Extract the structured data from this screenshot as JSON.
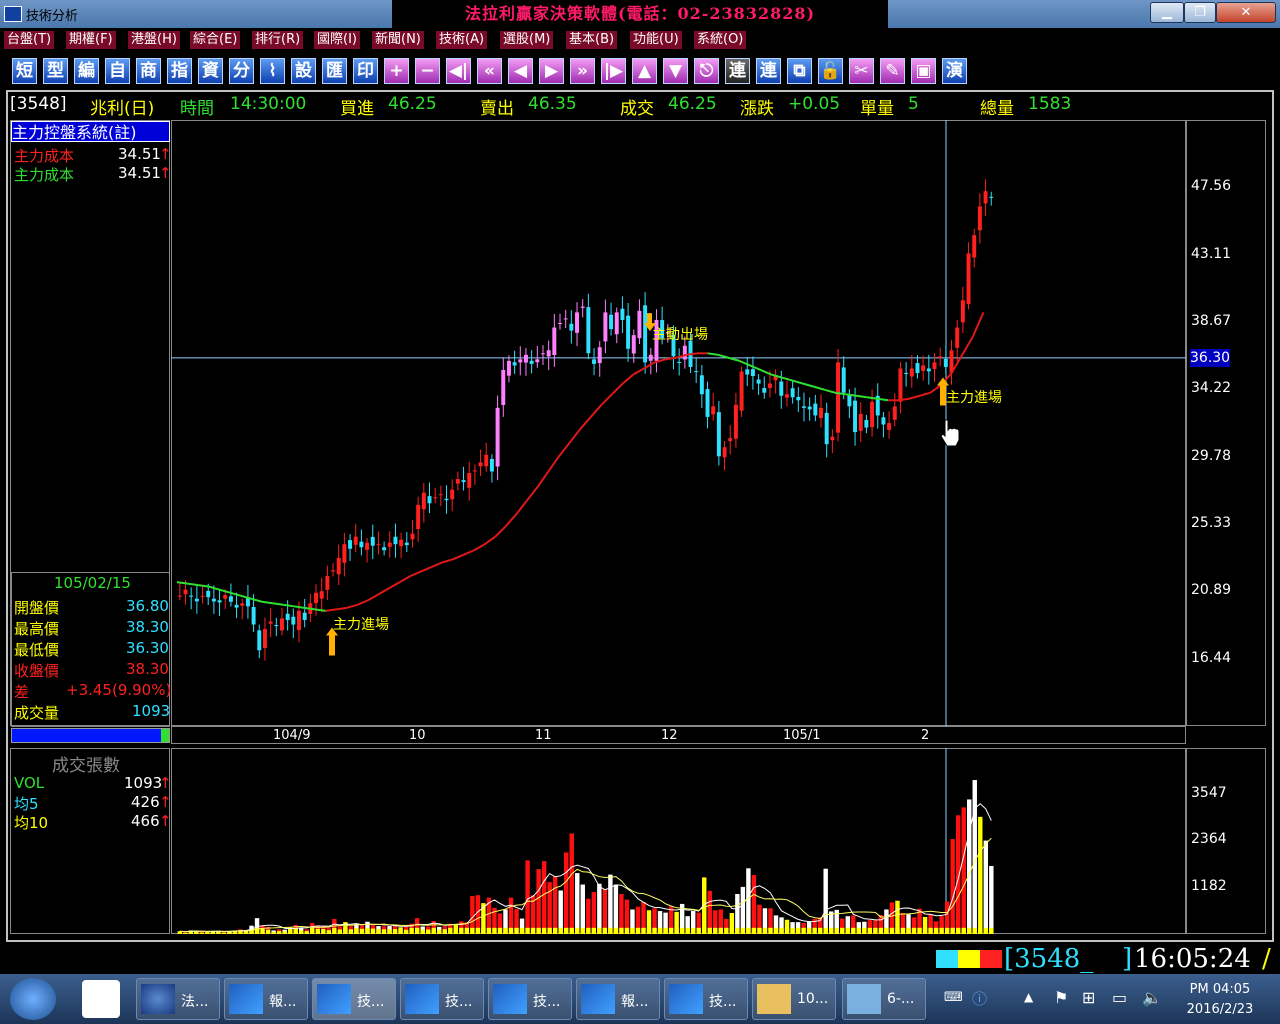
{
  "window": {
    "title": "技術分析",
    "banner": "法拉利贏家決策軟體(電話：02-23832828)"
  },
  "menu": [
    "台盤(T)",
    "期權(F)",
    "港盤(H)",
    "綜合(E)",
    "排行(R)",
    "國際(I)",
    "新聞(N)",
    "技術(A)",
    "選股(M)",
    "基本(B)",
    "功能(U)",
    "系統(O)"
  ],
  "toolbar": {
    "text_buttons": [
      "短",
      "型",
      "編",
      "自",
      "商",
      "指",
      "資",
      "分",
      "設",
      "匯",
      "印"
    ],
    "link_buttons": [
      "連",
      "連",
      "演"
    ]
  },
  "status": {
    "code": "[3548]",
    "name": "兆利(日)",
    "time_label": "時間",
    "time": "14:30:00",
    "buy_label": "買進",
    "buy": "46.25",
    "sell_label": "賣出",
    "sell": "46.35",
    "deal_label": "成交",
    "deal": "46.25",
    "change_label": "漲跌",
    "change": "+0.05",
    "unit_label": "單量",
    "unit": "5",
    "total_label": "總量",
    "total": "1583"
  },
  "indicator": {
    "title": "主力控盤系統(註)",
    "line1_label": "主力成本",
    "line1_value": "34.51",
    "line2_label": "主力成本",
    "line2_value": "34.51"
  },
  "ohlc": {
    "date": "105/02/15",
    "open_label": "開盤價",
    "open": "36.80",
    "high_label": "最高價",
    "high": "38.30",
    "low_label": "最低價",
    "low": "36.30",
    "close_label": "收盤價",
    "close": "38.30",
    "diff_label": "差",
    "diff": "+3.45(9.90%)",
    "vol_label": "成交量",
    "vol": "1093"
  },
  "annotations": {
    "enter1": "主力進場",
    "exit": "主動出場",
    "enter2": "主力進場"
  },
  "crosshair_price": "36.30",
  "volume": {
    "title": "成交張數",
    "vol_label": "VOL",
    "vol": "1093",
    "ma5_label": "均5",
    "ma5": "426",
    "ma10_label": "均10",
    "ma10": "466"
  },
  "clock": {
    "code": "[3548_",
    "time": "16:05:24"
  },
  "taskbar": {
    "items": [
      "法...",
      "報...",
      "技...",
      "技...",
      "技...",
      "報...",
      "技...",
      "10...",
      "6-..."
    ],
    "time": "PM 04:05",
    "date": "2016/2/23"
  },
  "chart_data": {
    "type": "candlestick",
    "y_ticks": [
      "47.56",
      "43.11",
      "38.67",
      "34.22",
      "29.78",
      "25.33",
      "20.89",
      "16.44"
    ],
    "ylim": [
      12.0,
      52.0
    ],
    "x_ticks": [
      "104/9",
      "10",
      "11",
      "12",
      "105/1",
      "2"
    ],
    "volume_ticks": [
      "3547",
      "2364",
      "1182"
    ],
    "volume_ylim": [
      0,
      4700
    ],
    "colors": {
      "up": "#ff2020",
      "down": "#30e0ff",
      "flat": "#ff80ff",
      "ma_up": "#e01818",
      "ma_down": "#30e030",
      "vol_up": "#ff1010",
      "vol_down": "#ffffff",
      "vol_other": "#ffff00"
    },
    "closes": [
      20.6,
      20.7,
      20.6,
      20.4,
      20.6,
      20.5,
      20.4,
      20.3,
      20.4,
      20.2,
      20.0,
      20.1,
      19.9,
      18.7,
      17.0,
      18.4,
      18.9,
      18.6,
      19.1,
      19.0,
      18.7,
      19.6,
      19.0,
      20.1,
      20.8,
      20.9,
      21.9,
      22.2,
      23.1,
      24.0,
      23.7,
      24.5,
      23.8,
      24.1,
      23.9,
      24.0,
      23.8,
      24.1,
      24.0,
      24.3,
      24.1,
      24.7,
      26.6,
      27.4,
      26.7,
      27.1,
      27.3,
      27.0,
      27.6,
      28.3,
      28.1,
      28.7,
      28.8,
      29.4,
      29.9,
      28.8,
      33.0,
      35.5,
      36.1,
      35.8,
      36.0,
      36.5,
      35.9,
      36.2,
      36.6,
      36.8,
      38.3,
      38.6,
      38.9,
      38.1,
      39.3,
      39.6,
      36.6,
      35.9,
      37.0,
      39.3,
      38.2,
      39.3,
      38.8,
      36.9,
      37.8,
      39.4,
      36.0,
      36.5,
      38.8,
      37.6,
      37.9,
      36.4,
      36.0,
      37.1,
      35.7,
      35.4,
      33.9,
      32.4,
      33.1,
      29.8,
      30.4,
      31.0,
      33.2,
      35.4,
      35.2,
      35.1,
      34.6,
      34.0,
      34.6,
      35.1,
      33.8,
      33.9,
      33.7,
      33.5,
      33.0,
      32.9,
      32.5,
      33.0,
      30.6,
      31.1,
      36.0,
      34.0,
      33.1,
      31.4,
      32.6,
      31.7,
      33.4,
      32.5,
      31.9,
      32.0,
      33.1,
      35.6,
      35.3,
      35.6,
      35.3,
      35.8,
      35.6,
      36.0,
      36.3,
      35.7,
      36.8,
      38.3,
      40.1,
      43.2,
      44.4,
      46.3,
      47.3,
      46.9
    ],
    "ma": [
      21.5,
      21.4,
      21.3,
      21.2,
      21.0,
      20.8,
      20.6,
      20.4,
      20.2,
      20.1,
      20.0,
      19.9,
      19.8,
      19.7,
      19.6,
      19.7,
      19.8,
      20.0,
      20.3,
      20.7,
      21.1,
      21.5,
      21.9,
      22.2,
      22.5,
      22.8,
      23.0,
      23.3,
      23.6,
      24.0,
      24.5,
      25.2,
      26.0,
      26.9,
      27.8,
      28.8,
      29.8,
      30.7,
      31.6,
      32.4,
      33.2,
      33.9,
      34.6,
      35.2,
      35.6,
      36.0,
      36.2,
      36.3,
      36.5,
      36.6,
      36.6,
      36.5,
      36.3,
      36.1,
      35.8,
      35.5,
      35.2,
      35.0,
      34.8,
      34.6,
      34.4,
      34.2,
      34.0,
      33.9,
      33.8,
      33.7,
      33.6,
      33.5,
      33.5,
      33.6,
      33.8,
      34.0,
      34.5,
      35.3,
      36.5,
      37.7,
      39.3
    ],
    "volumes": [
      70,
      50,
      90,
      80,
      60,
      50,
      70,
      80,
      60,
      70,
      90,
      120,
      100,
      210,
      400,
      220,
      180,
      90,
      120,
      110,
      160,
      230,
      160,
      120,
      280,
      220,
      210,
      160,
      380,
      190,
      300,
      200,
      250,
      220,
      310,
      230,
      200,
      200,
      200,
      210,
      170,
      180,
      260,
      400,
      190,
      190,
      330,
      180,
      200,
      260,
      240,
      320,
      300,
      960,
      980,
      780,
      920,
      660,
      520,
      620,
      920,
      630,
      390,
      1860,
      980,
      1640,
      1840,
      1310,
      1460,
      1100,
      2060,
      2540,
      1540,
      1250,
      890,
      1060,
      1270,
      1130,
      1500,
      1250,
      1010,
      870,
      620,
      690,
      810,
      600,
      650,
      580,
      540,
      700,
      560,
      760,
      450,
      580,
      540,
      1430,
      1090,
      600,
      620,
      380,
      530,
      1010,
      1190,
      1660,
      1490,
      740,
      650,
      650,
      470,
      420,
      360,
      300,
      300,
      280,
      320,
      380,
      420,
      1650,
      570,
      610,
      390,
      450,
      470,
      300,
      310,
      350,
      350,
      480,
      620,
      800,
      840,
      530,
      500,
      420,
      640,
      430,
      490,
      320,
      450,
      820,
      2400,
      3000,
      3200,
      3400,
      3890,
      2960,
      2360,
      1720
    ]
  }
}
